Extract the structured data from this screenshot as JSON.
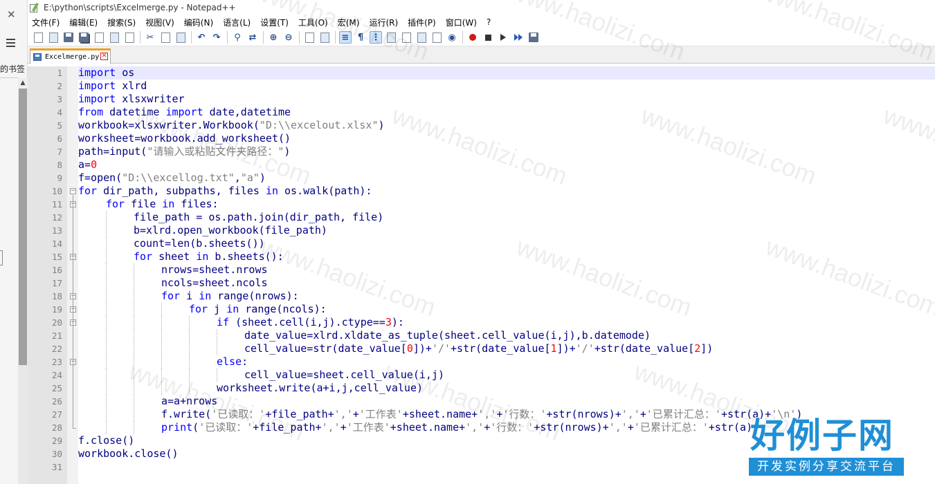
{
  "left_strip": {
    "close_glyph": "✕",
    "bookmark_label": "的书签"
  },
  "window": {
    "title": "E:\\python\\scripts\\Excelmerge.py - Notepad++"
  },
  "menu": [
    "文件(F)",
    "编辑(E)",
    "搜索(S)",
    "视图(V)",
    "编码(N)",
    "语言(L)",
    "设置(T)",
    "工具(O)",
    "宏(M)",
    "运行(R)",
    "插件(P)",
    "窗口(W)",
    "?"
  ],
  "toolbar_icons": [
    "new-file-icon",
    "open-file-icon",
    "save-icon",
    "save-all-icon",
    "close-icon",
    "close-all-icon",
    "print-icon",
    "cut-icon",
    "copy-icon",
    "paste-icon",
    "undo-icon",
    "redo-icon",
    "find-icon",
    "replace-icon",
    "zoom-in-icon",
    "zoom-out-icon",
    "sync-v-icon",
    "sync-h-icon",
    "word-wrap-icon",
    "show-all-chars-icon",
    "indent-guide-icon",
    "udl-icon",
    "doc-map-icon",
    "function-list-icon",
    "folder-workspace-icon",
    "monitor-icon",
    "record-macro-icon",
    "stop-record-icon",
    "play-macro-icon",
    "run-macro-multiple-icon",
    "save-macro-icon"
  ],
  "tab": {
    "label": "Excelmerge.py",
    "close_glyph": "✕"
  },
  "editor": {
    "current_line": 1,
    "lines": [
      {
        "n": "1",
        "indent": 0,
        "tokens": [
          [
            "kw",
            "import"
          ],
          [
            "plain",
            " os"
          ]
        ]
      },
      {
        "n": "2",
        "indent": 0,
        "tokens": [
          [
            "kw",
            "import"
          ],
          [
            "plain",
            " xlrd"
          ]
        ]
      },
      {
        "n": "3",
        "indent": 0,
        "tokens": [
          [
            "kw",
            "import"
          ],
          [
            "plain",
            " xlsxwriter"
          ]
        ]
      },
      {
        "n": "4",
        "indent": 0,
        "tokens": [
          [
            "kw",
            "from"
          ],
          [
            "plain",
            " datetime "
          ],
          [
            "kw",
            "import"
          ],
          [
            "plain",
            " date,datetime"
          ]
        ]
      },
      {
        "n": "5",
        "indent": 0,
        "tokens": [
          [
            "plain",
            "workbook=xlsxwriter.Workbook("
          ],
          [
            "str",
            "\"D:\\\\excelout.xlsx\""
          ],
          [
            "plain",
            ")"
          ]
        ]
      },
      {
        "n": "6",
        "indent": 0,
        "tokens": [
          [
            "plain",
            "worksheet=workbook.add_worksheet()"
          ]
        ]
      },
      {
        "n": "7",
        "indent": 0,
        "tokens": [
          [
            "plain",
            "path=input("
          ],
          [
            "str",
            "\"请输入或粘贴文件夹路径：\""
          ],
          [
            "plain",
            ")"
          ]
        ]
      },
      {
        "n": "8",
        "indent": 0,
        "tokens": [
          [
            "plain",
            "a="
          ],
          [
            "num",
            "0"
          ]
        ]
      },
      {
        "n": "9",
        "indent": 0,
        "tokens": [
          [
            "plain",
            "f=open("
          ],
          [
            "str",
            "\"D:\\\\excellog.txt\""
          ],
          [
            "plain",
            ","
          ],
          [
            "str",
            "\"a\""
          ],
          [
            "plain",
            ")"
          ]
        ]
      },
      {
        "n": "10",
        "indent": 0,
        "tokens": [
          [
            "kw",
            "for"
          ],
          [
            "plain",
            " dir_path, subpaths, files "
          ],
          [
            "kw",
            "in"
          ],
          [
            "plain",
            " os.walk(path):"
          ]
        ]
      },
      {
        "n": "11",
        "indent": 1,
        "tokens": [
          [
            "kw",
            "for"
          ],
          [
            "plain",
            " file "
          ],
          [
            "kw",
            "in"
          ],
          [
            "plain",
            " files:"
          ]
        ]
      },
      {
        "n": "12",
        "indent": 2,
        "tokens": [
          [
            "plain",
            "file_path = os.path.join(dir_path, file)"
          ]
        ]
      },
      {
        "n": "13",
        "indent": 2,
        "tokens": [
          [
            "plain",
            "b=xlrd.open_workbook(file_path)"
          ]
        ]
      },
      {
        "n": "14",
        "indent": 2,
        "tokens": [
          [
            "plain",
            "count=len(b.sheets())"
          ]
        ]
      },
      {
        "n": "15",
        "indent": 2,
        "tokens": [
          [
            "kw",
            "for"
          ],
          [
            "plain",
            " sheet "
          ],
          [
            "kw",
            "in"
          ],
          [
            "plain",
            " b.sheets():"
          ]
        ]
      },
      {
        "n": "16",
        "indent": 3,
        "tokens": [
          [
            "plain",
            "nrows=sheet.nrows"
          ]
        ]
      },
      {
        "n": "17",
        "indent": 3,
        "tokens": [
          [
            "plain",
            "ncols=sheet.ncols"
          ]
        ]
      },
      {
        "n": "18",
        "indent": 3,
        "tokens": [
          [
            "kw",
            "for"
          ],
          [
            "plain",
            " i "
          ],
          [
            "kw",
            "in"
          ],
          [
            "plain",
            " range(nrows):"
          ]
        ]
      },
      {
        "n": "19",
        "indent": 4,
        "tokens": [
          [
            "kw",
            "for"
          ],
          [
            "plain",
            " j "
          ],
          [
            "kw",
            "in"
          ],
          [
            "plain",
            " range(ncols):"
          ]
        ]
      },
      {
        "n": "20",
        "indent": 5,
        "tokens": [
          [
            "kw",
            "if"
          ],
          [
            "plain",
            " (sheet.cell(i,j).ctype=="
          ],
          [
            "num",
            "3"
          ],
          [
            "plain",
            "):"
          ]
        ]
      },
      {
        "n": "21",
        "indent": 6,
        "tokens": [
          [
            "plain",
            "date_value=xlrd.xldate_as_tuple(sheet.cell_value(i,j),b.datemode)"
          ]
        ]
      },
      {
        "n": "22",
        "indent": 6,
        "tokens": [
          [
            "plain",
            "cell_value=str(date_value["
          ],
          [
            "num",
            "0"
          ],
          [
            "plain",
            "])+"
          ],
          [
            "str",
            "'/'"
          ],
          [
            "plain",
            "+str(date_value["
          ],
          [
            "num",
            "1"
          ],
          [
            "plain",
            "])+"
          ],
          [
            "str",
            "'/'"
          ],
          [
            "plain",
            "+str(date_value["
          ],
          [
            "num",
            "2"
          ],
          [
            "plain",
            "])"
          ]
        ]
      },
      {
        "n": "23",
        "indent": 5,
        "tokens": [
          [
            "kw",
            "else"
          ],
          [
            "plain",
            ":"
          ]
        ]
      },
      {
        "n": "24",
        "indent": 6,
        "tokens": [
          [
            "plain",
            "cell_value=sheet.cell_value(i,j)"
          ]
        ]
      },
      {
        "n": "25",
        "indent": 5,
        "tokens": [
          [
            "plain",
            "worksheet.write(a+i,j,cell_value)"
          ]
        ]
      },
      {
        "n": "26",
        "indent": 3,
        "tokens": [
          [
            "plain",
            "a=a+nrows"
          ]
        ]
      },
      {
        "n": "27",
        "indent": 3,
        "tokens": [
          [
            "plain",
            "f.write("
          ],
          [
            "str",
            "'已读取：'"
          ],
          [
            "plain",
            "+file_path+"
          ],
          [
            "str",
            "','"
          ],
          [
            "plain",
            "+"
          ],
          [
            "str",
            "'工作表'"
          ],
          [
            "plain",
            "+sheet.name+"
          ],
          [
            "str",
            "','"
          ],
          [
            "plain",
            "+"
          ],
          [
            "str",
            "'行数：'"
          ],
          [
            "plain",
            "+str(nrows)+"
          ],
          [
            "str",
            "','"
          ],
          [
            "plain",
            "+"
          ],
          [
            "str",
            "'已累计汇总：'"
          ],
          [
            "plain",
            "+str(a)+"
          ],
          [
            "str",
            "'\\n'"
          ],
          [
            "plain",
            ")"
          ]
        ]
      },
      {
        "n": "28",
        "indent": 3,
        "tokens": [
          [
            "kw",
            "print"
          ],
          [
            "plain",
            "("
          ],
          [
            "str",
            "'已读取：'"
          ],
          [
            "plain",
            "+file_path+"
          ],
          [
            "str",
            "','"
          ],
          [
            "plain",
            "+"
          ],
          [
            "str",
            "'工作表'"
          ],
          [
            "plain",
            "+sheet.name+"
          ],
          [
            "str",
            "','"
          ],
          [
            "plain",
            "+"
          ],
          [
            "str",
            "'行数：'"
          ],
          [
            "plain",
            "+str(nrows)+"
          ],
          [
            "str",
            "','"
          ],
          [
            "plain",
            "+"
          ],
          [
            "str",
            "'已累计汇总：'"
          ],
          [
            "plain",
            "+str(a))"
          ]
        ]
      },
      {
        "n": "29",
        "indent": 0,
        "tokens": [
          [
            "plain",
            "f.close()"
          ]
        ]
      },
      {
        "n": "30",
        "indent": 0,
        "tokens": [
          [
            "plain",
            "workbook.close()"
          ]
        ]
      },
      {
        "n": "31",
        "indent": 0,
        "tokens": []
      }
    ]
  },
  "watermark_text": "www.haolizi.com",
  "brand": {
    "name": "好例子网",
    "subtitle": "开发实例分享交流平台",
    "color": "#1f8fd6"
  }
}
